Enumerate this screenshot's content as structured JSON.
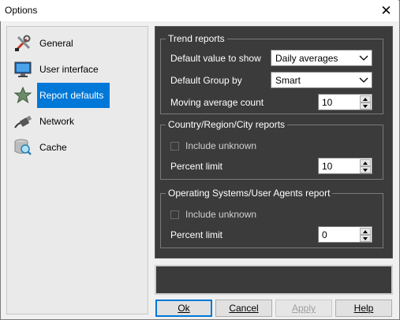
{
  "window": {
    "title": "Options",
    "close_glyph": "✕"
  },
  "nav": {
    "items": [
      {
        "label": "General",
        "icon": "tools-icon",
        "selected": false
      },
      {
        "label": "User interface",
        "icon": "monitor-icon",
        "selected": false
      },
      {
        "label": "Report defaults",
        "icon": "star-report-icon",
        "selected": true
      },
      {
        "label": "Network",
        "icon": "network-cable-icon",
        "selected": false
      },
      {
        "label": "Cache",
        "icon": "database-search-icon",
        "selected": false
      }
    ]
  },
  "trend": {
    "legend": "Trend reports",
    "default_value_label": "Default value to show",
    "default_value": "Daily averages",
    "default_group_label": "Default Group by",
    "default_group": "Smart",
    "moving_avg_label": "Moving average count",
    "moving_avg": "10"
  },
  "country": {
    "legend": "Country/Region/City reports",
    "include_unknown_label": "Include unknown",
    "include_unknown": false,
    "percent_limit_label": "Percent limit",
    "percent_limit": "10"
  },
  "os": {
    "legend": "Operating Systems/User Agents report",
    "include_unknown_label": "Include unknown",
    "include_unknown": false,
    "percent_limit_label": "Percent limit",
    "percent_limit": "0"
  },
  "buttons": {
    "ok": "Ok",
    "cancel": "Cancel",
    "apply": "Apply",
    "help": "Help"
  }
}
